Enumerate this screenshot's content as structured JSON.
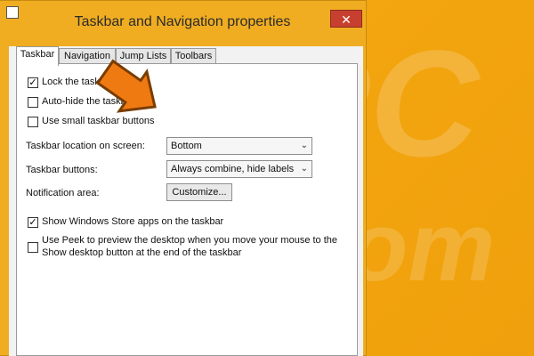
{
  "window": {
    "title": "Taskbar and Navigation properties",
    "close_symbol": "✕",
    "icon": "properties-icon"
  },
  "tabs": [
    {
      "label": "Taskbar",
      "active": true
    },
    {
      "label": "Navigation",
      "active": false
    },
    {
      "label": "Jump Lists",
      "active": false
    },
    {
      "label": "Toolbars",
      "active": false
    }
  ],
  "options": {
    "lock_taskbar": {
      "label": "Lock the taskbar",
      "checked": true
    },
    "auto_hide": {
      "label": "Auto-hide the taskbar",
      "checked": false
    },
    "small_buttons": {
      "label": "Use small taskbar buttons",
      "checked": false
    },
    "store_apps": {
      "label": "Show Windows Store apps on the taskbar",
      "checked": true
    },
    "peek": {
      "label_line1": "Use Peek to preview the desktop when you move your mouse to the",
      "label_line2": "Show desktop button at the end of the taskbar",
      "checked": false
    }
  },
  "settings": {
    "location": {
      "label": "Taskbar location on screen:",
      "value": "Bottom"
    },
    "buttons": {
      "label": "Taskbar buttons:",
      "value": "Always combine, hide labels"
    },
    "notification": {
      "label": "Notification area:",
      "button": "Customize..."
    }
  },
  "watermark": {
    "text": "PC risk.com"
  },
  "colors": {
    "background": "#f3a50f",
    "arrow": "#f07a12"
  }
}
